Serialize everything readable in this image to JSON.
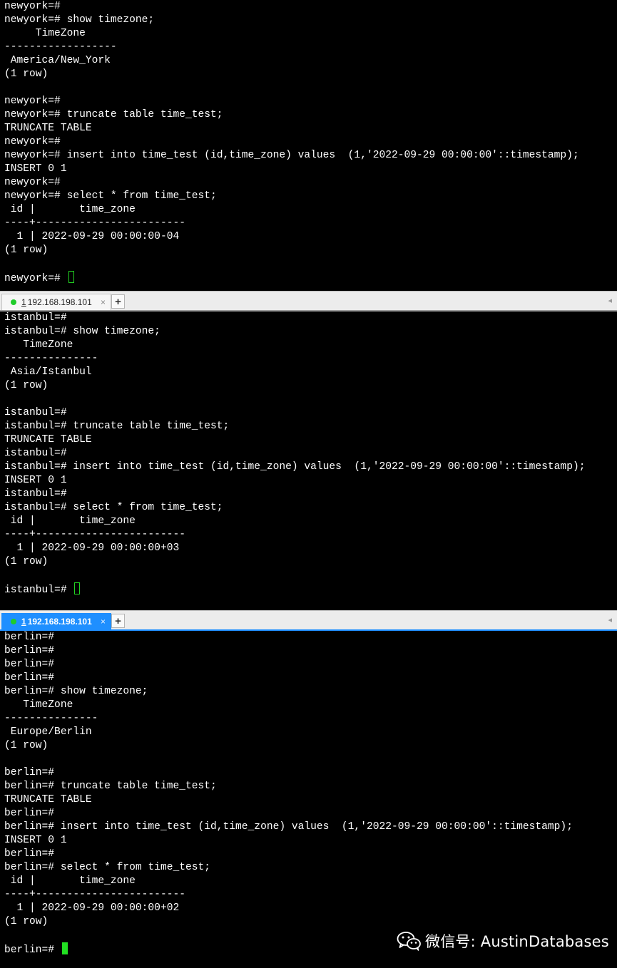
{
  "panes": [
    {
      "name": "newyork",
      "lines": [
        "newyork=#",
        "newyork=# show timezone;",
        "     TimeZone",
        "------------------",
        " America/New_York",
        "(1 row)",
        "",
        "newyork=#",
        "newyork=# truncate table time_test;",
        "TRUNCATE TABLE",
        "newyork=#",
        "newyork=# insert into time_test (id,time_zone) values  (1,'2022-09-29 00:00:00'::timestamp);",
        "INSERT 0 1",
        "newyork=#",
        "newyork=# select * from time_test;",
        " id |       time_zone",
        "----+------------------------",
        "  1 | 2022-09-29 00:00:00-04",
        "(1 row)",
        ""
      ],
      "prompt": "newyork=# "
    },
    {
      "name": "istanbul",
      "lines": [
        "istanbul=#",
        "istanbul=# show timezone;",
        "   TimeZone",
        "---------------",
        " Asia/Istanbul",
        "(1 row)",
        "",
        "istanbul=#",
        "istanbul=# truncate table time_test;",
        "TRUNCATE TABLE",
        "istanbul=#",
        "istanbul=# insert into time_test (id,time_zone) values  (1,'2022-09-29 00:00:00'::timestamp);",
        "INSERT 0 1",
        "istanbul=#",
        "istanbul=# select * from time_test;",
        " id |       time_zone",
        "----+------------------------",
        "  1 | 2022-09-29 00:00:00+03",
        "(1 row)",
        ""
      ],
      "prompt": "istanbul=# "
    },
    {
      "name": "berlin",
      "lines": [
        "berlin=#",
        "berlin=#",
        "berlin=#",
        "berlin=#",
        "berlin=# show timezone;",
        "   TimeZone",
        "---------------",
        " Europe/Berlin",
        "(1 row)",
        "",
        "berlin=#",
        "berlin=# truncate table time_test;",
        "TRUNCATE TABLE",
        "berlin=#",
        "berlin=# insert into time_test (id,time_zone) values  (1,'2022-09-29 00:00:00'::timestamp);",
        "INSERT 0 1",
        "berlin=#",
        "berlin=# select * from time_test;",
        " id |       time_zone",
        "----+------------------------",
        "  1 | 2022-09-29 00:00:00+02",
        "(1 row)",
        ""
      ],
      "prompt": "berlin=# "
    }
  ],
  "tabs": [
    {
      "number": "1",
      "title": " 192.168.198.101",
      "close": "×",
      "active": false
    },
    {
      "number": "1",
      "title": " 192.168.198.101",
      "close": "×",
      "active": true
    }
  ],
  "tab_add_label": "+",
  "tab_scroll_label": "◂",
  "watermark": {
    "text": "微信号: AustinDatabases",
    "icon": "wechat-icon"
  },
  "colors": {
    "terminal_bg": "#000000",
    "terminal_fg": "#ffffff",
    "cursor": "#22e022",
    "active_tab": "#1f8fff",
    "status_dot": "#1fcc2a"
  }
}
